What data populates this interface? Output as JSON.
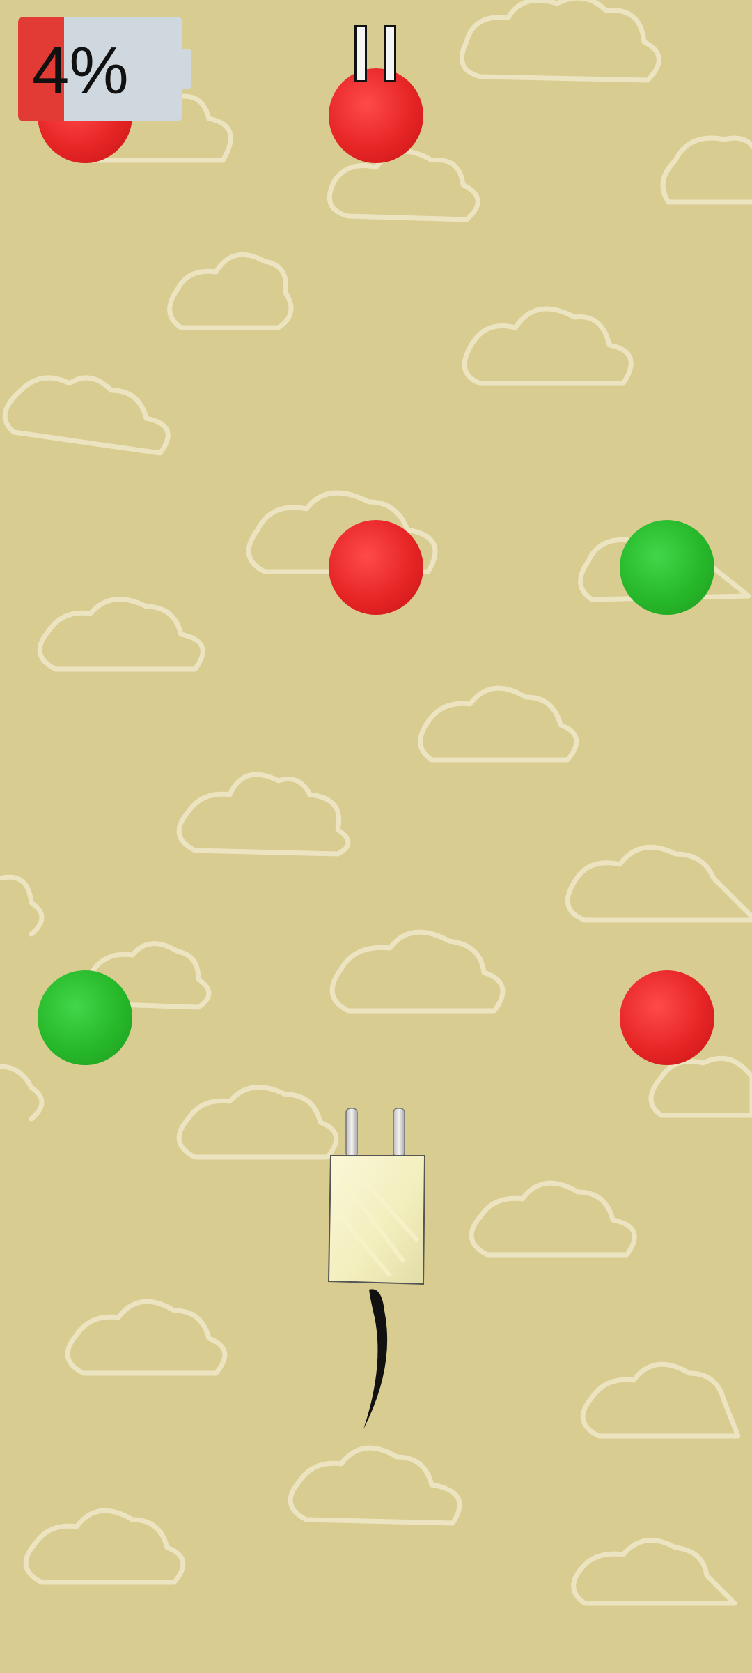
{
  "hud": {
    "battery_percent_label": "4%",
    "battery_fill_fraction": 0.28,
    "battery_color": "#e23a34"
  },
  "icons": {
    "pause": "pause-icon",
    "player": "power-plug-icon"
  },
  "colors": {
    "background": "#d8cc90",
    "red_dot": "#e62525",
    "green_dot": "#27b82a"
  }
}
